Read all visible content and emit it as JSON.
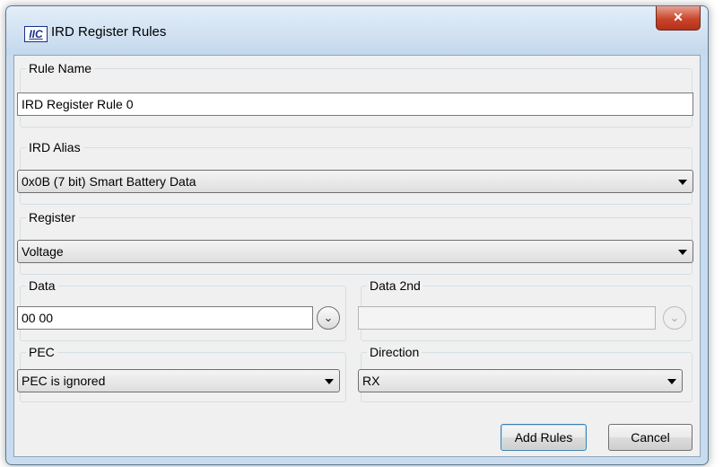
{
  "window": {
    "icon_text": "IIC",
    "title": "IRD Register Rules",
    "close_glyph": "✕"
  },
  "rule_name": {
    "label": "Rule Name",
    "value": "IRD Register Rule 0"
  },
  "ird_alias": {
    "label": "IRD Alias",
    "selected": "0x0B (7 bit) Smart Battery Data"
  },
  "register": {
    "label": "Register",
    "selected": "Voltage"
  },
  "data": {
    "label": "Data",
    "value": "00 00",
    "expand_glyph": "⌄"
  },
  "data_2nd": {
    "label": "Data 2nd",
    "value": "",
    "expand_glyph": "⌄"
  },
  "pec": {
    "label": "PEC",
    "selected": "PEC is ignored"
  },
  "direction": {
    "label": "Direction",
    "selected": "RX"
  },
  "buttons": {
    "add_rules": "Add Rules",
    "cancel": "Cancel"
  },
  "icons": {
    "app": "iic-app-icon",
    "close": "close-icon",
    "dropdown": "chevron-down-icon",
    "expand": "expand-circle-icon"
  }
}
